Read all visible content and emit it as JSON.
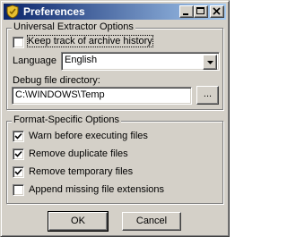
{
  "window": {
    "title": "Preferences"
  },
  "universal": {
    "legend": "Universal Extractor Options",
    "history": {
      "label": "Keep track of archive history",
      "checked": false
    },
    "language": {
      "label": "Language",
      "value": "English"
    },
    "debug": {
      "label": "Debug file directory:",
      "value": "C:\\WINDOWS\\Temp",
      "browse_label": "..."
    }
  },
  "format": {
    "legend": "Format-Specific Options",
    "options": [
      {
        "label": "Warn before executing files",
        "checked": true
      },
      {
        "label": "Remove duplicate files",
        "checked": true
      },
      {
        "label": "Remove temporary files",
        "checked": true
      },
      {
        "label": "Append missing file extensions",
        "checked": false
      }
    ]
  },
  "buttons": {
    "ok": "OK",
    "cancel": "Cancel"
  }
}
